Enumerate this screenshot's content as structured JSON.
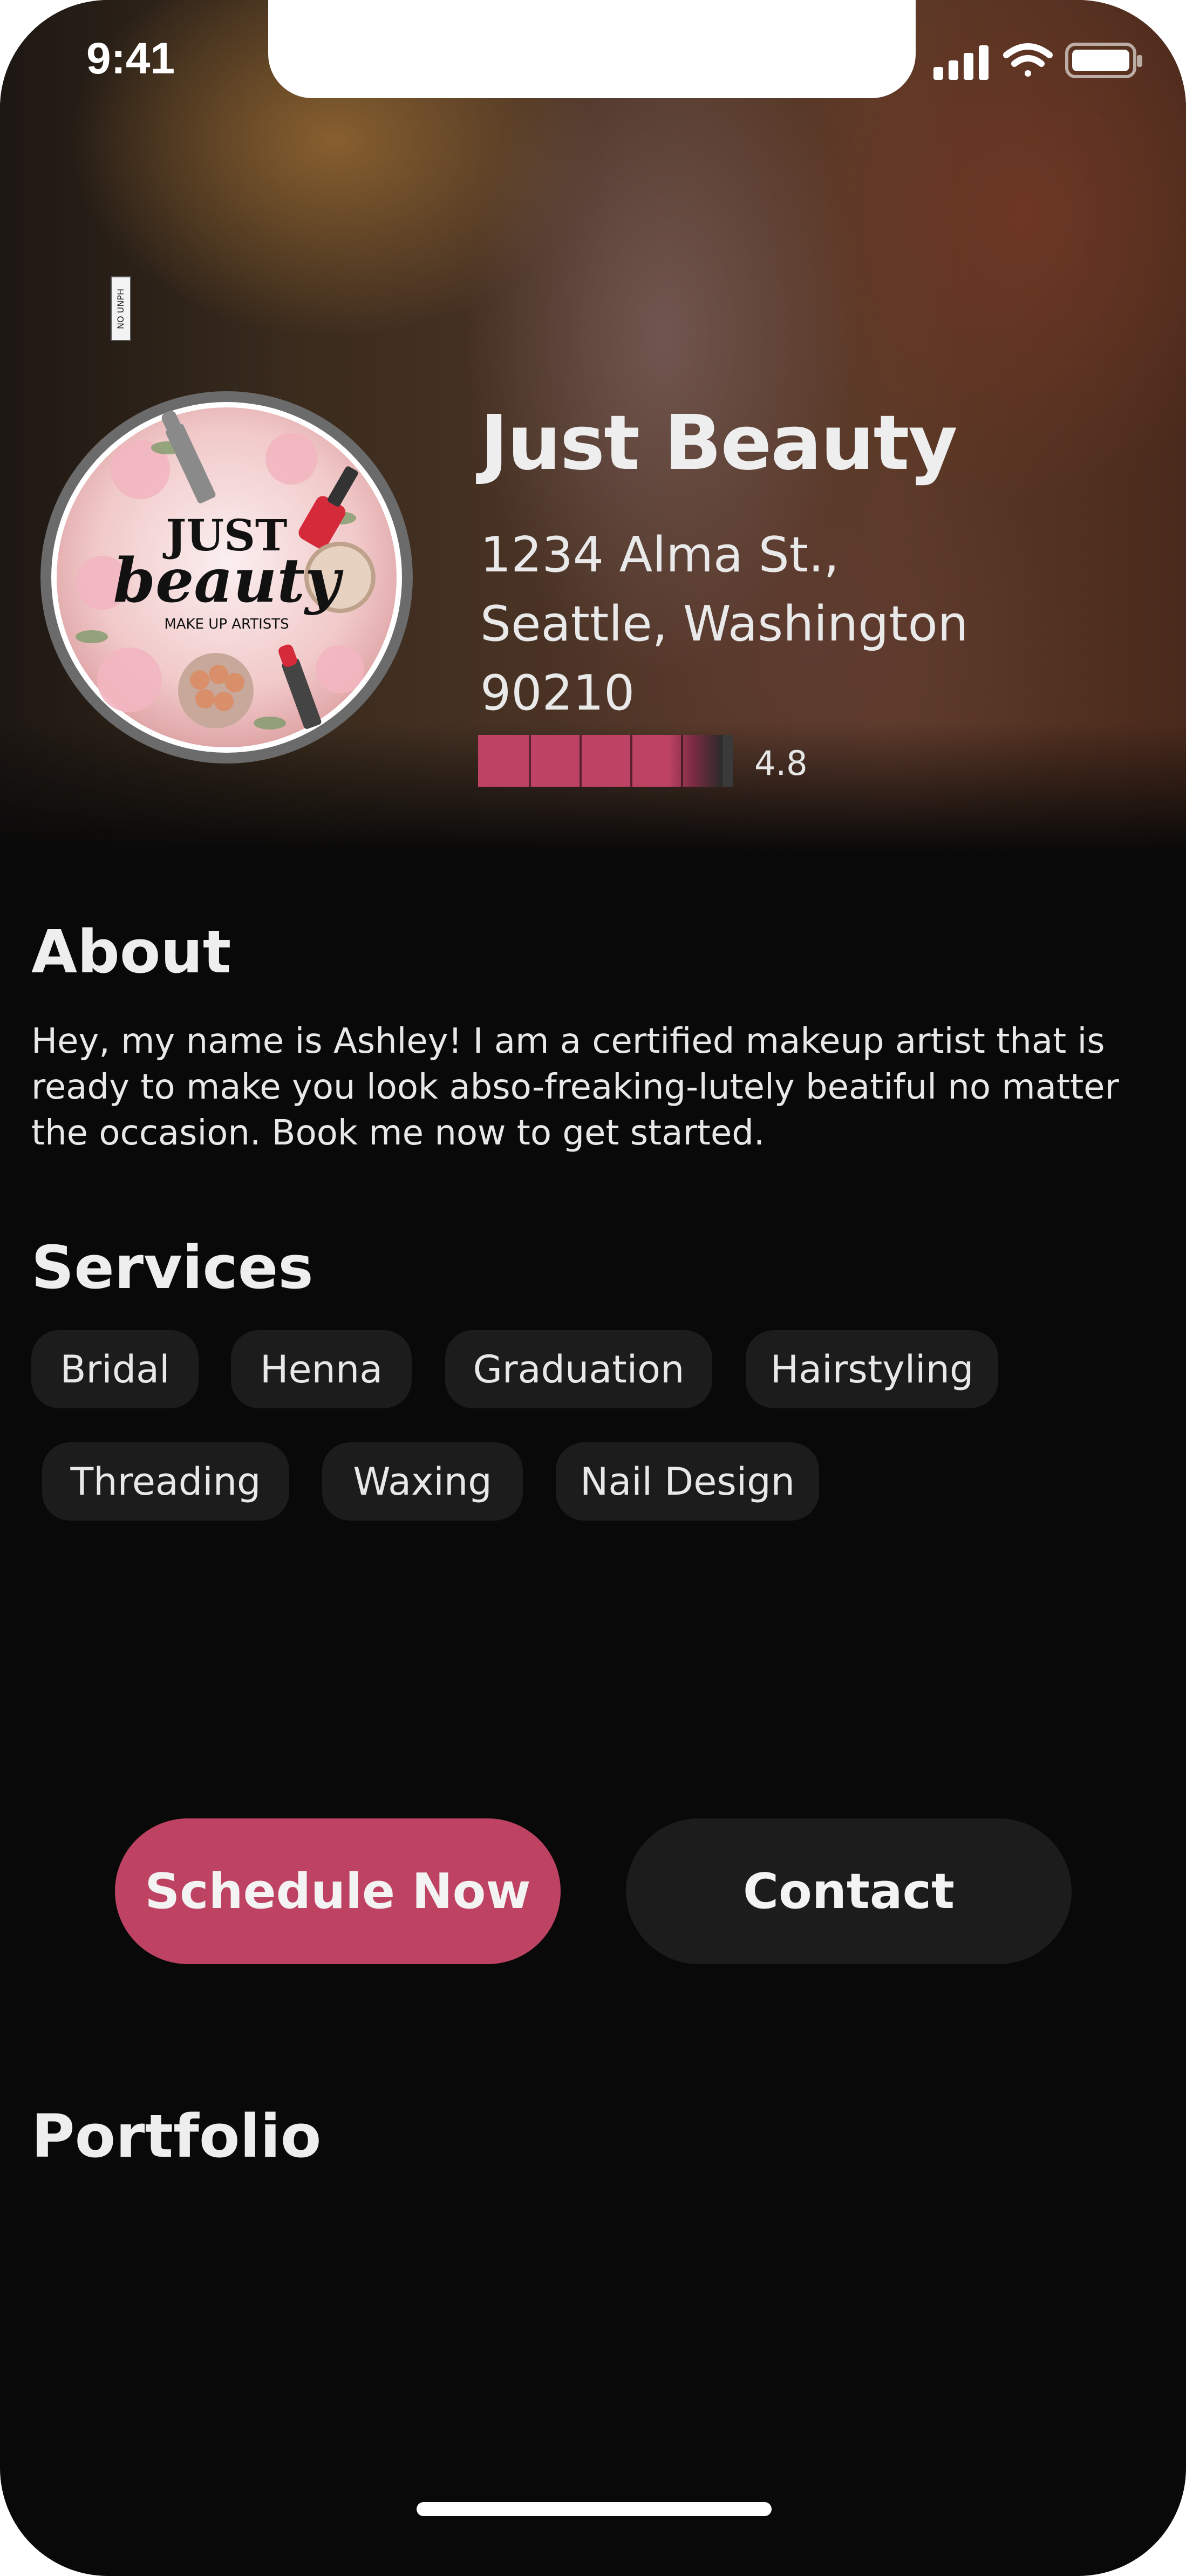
{
  "status_bar": {
    "time": "9:41",
    "icons": [
      "signal-icon",
      "wifi-icon",
      "battery-icon"
    ]
  },
  "profile": {
    "side_tag": "NO UNPH",
    "logo": {
      "line1": "JUST",
      "line2": "beauty",
      "line3": "MAKE UP ARTISTS"
    },
    "name": "Just Beauty",
    "address_line1": "1234 Alma St.,",
    "address_line2": "Seattle, Washington",
    "address_line3": "90210",
    "rating_value": "4.8",
    "rating_fraction": 0.96
  },
  "about": {
    "title": "About",
    "text": "Hey, my name is Ashley! I am a certified makeup artist that is ready to make you look abso-freaking-lutely beatiful no matter the occasion. Book me now to get started."
  },
  "services": {
    "title": "Services",
    "items": [
      "Bridal",
      "Henna",
      "Graduation",
      "Hairstyling",
      "Threading",
      "Waxing",
      "Nail Design"
    ]
  },
  "actions": {
    "schedule_label": "Schedule Now",
    "contact_label": "Contact"
  },
  "portfolio": {
    "title": "Portfolio"
  },
  "colors": {
    "accent": "#be4262",
    "background": "#090909",
    "chip": "#1c1c1c"
  }
}
